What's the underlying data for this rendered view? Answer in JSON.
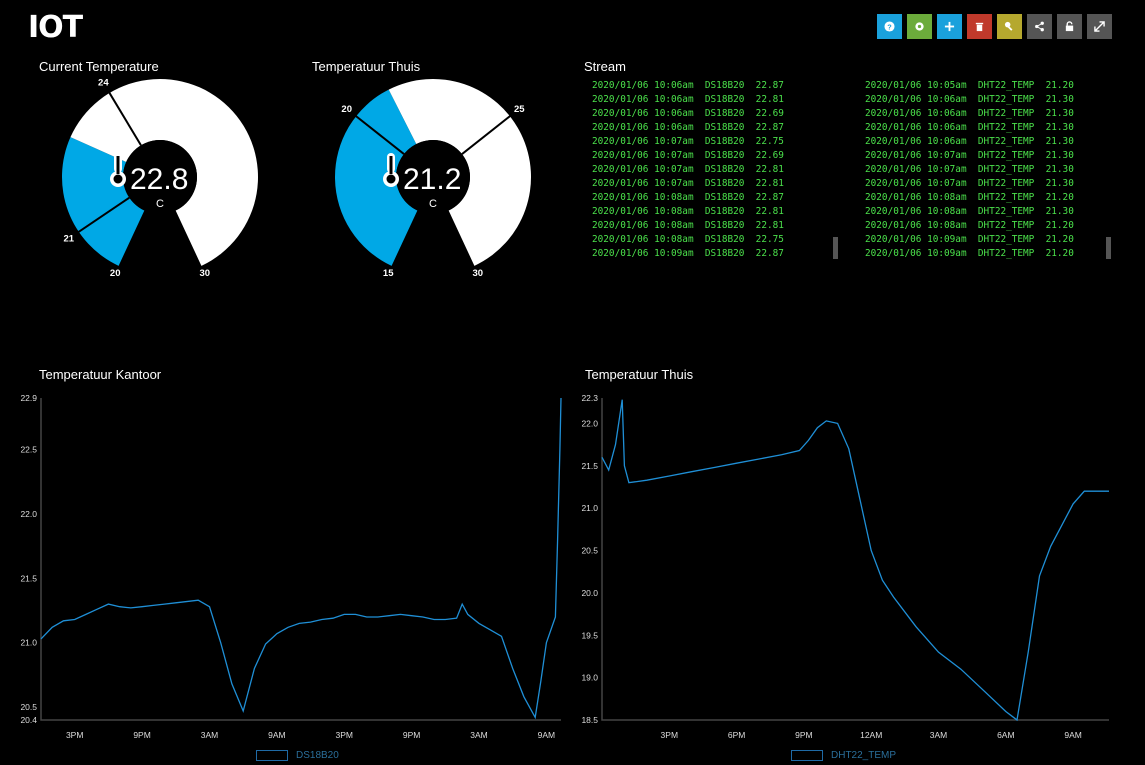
{
  "app": {
    "title": "IOT"
  },
  "toolbar": {
    "buttons": [
      {
        "name": "help",
        "icon": "question-icon",
        "color": "#1aa1dc"
      },
      {
        "name": "settings",
        "icon": "gear-icon",
        "color": "#6cab3b"
      },
      {
        "name": "add",
        "icon": "plus-icon",
        "color": "#1aa1dc"
      },
      {
        "name": "delete",
        "icon": "trash-icon",
        "color": "#c0392b"
      },
      {
        "name": "key",
        "icon": "key-icon",
        "color": "#b5a82e"
      },
      {
        "name": "share",
        "icon": "share-icon",
        "color": "#555555"
      },
      {
        "name": "lock",
        "icon": "lock-icon",
        "color": "#555555"
      },
      {
        "name": "fullscreen",
        "icon": "expand-icon",
        "color": "#555555"
      }
    ]
  },
  "gauges": [
    {
      "title": "Current Temperature",
      "value": "22.8",
      "unit": "C",
      "min": 20,
      "max": 30,
      "value_num": 22.87,
      "low_label": "21",
      "high_label": "24",
      "min_label": "20",
      "max_label": "30",
      "fill_color": "#00a8e6"
    },
    {
      "title": "Temperatuur Thuis",
      "value": "21.2",
      "unit": "C",
      "min": 15,
      "max": 30,
      "value_num": 21.2,
      "low_label": "20",
      "high_label": "25",
      "min_label": "15",
      "max_label": "30",
      "fill_color": "#00a8e6"
    }
  ],
  "stream": {
    "title": "Stream",
    "left": [
      "2020/01/06 10:06am  DS18B20  22.87",
      "2020/01/06 10:06am  DS18B20  22.81",
      "2020/01/06 10:06am  DS18B20  22.69",
      "2020/01/06 10:06am  DS18B20  22.87",
      "2020/01/06 10:07am  DS18B20  22.75",
      "2020/01/06 10:07am  DS18B20  22.69",
      "2020/01/06 10:07am  DS18B20  22.81",
      "2020/01/06 10:07am  DS18B20  22.81",
      "2020/01/06 10:08am  DS18B20  22.87",
      "2020/01/06 10:08am  DS18B20  22.81",
      "2020/01/06 10:08am  DS18B20  22.81",
      "2020/01/06 10:08am  DS18B20  22.75",
      "2020/01/06 10:09am  DS18B20  22.87"
    ],
    "right": [
      "2020/01/06 10:05am  DHT22_TEMP  21.20",
      "2020/01/06 10:06am  DHT22_TEMP  21.30",
      "2020/01/06 10:06am  DHT22_TEMP  21.30",
      "2020/01/06 10:06am  DHT22_TEMP  21.30",
      "2020/01/06 10:06am  DHT22_TEMP  21.30",
      "2020/01/06 10:07am  DHT22_TEMP  21.30",
      "2020/01/06 10:07am  DHT22_TEMP  21.30",
      "2020/01/06 10:07am  DHT22_TEMP  21.30",
      "2020/01/06 10:08am  DHT22_TEMP  21.20",
      "2020/01/06 10:08am  DHT22_TEMP  21.30",
      "2020/01/06 10:08am  DHT22_TEMP  21.20",
      "2020/01/06 10:09am  DHT22_TEMP  21.20",
      "2020/01/06 10:09am  DHT22_TEMP  21.20"
    ]
  },
  "chart_data": [
    {
      "type": "line",
      "title": "Temperatuur Kantoor",
      "series": [
        {
          "name": "DS18B20",
          "color": "#1f8fd6"
        }
      ],
      "ylim": [
        20.4,
        22.9
      ],
      "yticks": [
        "22.9",
        "22.5",
        "22.0",
        "21.5",
        "21.0",
        "20.5",
        "20.4"
      ],
      "ytick_values": [
        22.9,
        22.5,
        22.0,
        21.5,
        21.0,
        20.5,
        20.4
      ],
      "xticks": [
        "3PM",
        "9PM",
        "3AM",
        "9AM",
        "3PM",
        "9PM",
        "3AM",
        "9AM"
      ],
      "xtick_hours": [
        3,
        9,
        15,
        21,
        27,
        33,
        39,
        45
      ],
      "x_hours_range": [
        0,
        46.3
      ],
      "points": [
        [
          0,
          21.03
        ],
        [
          1,
          21.12
        ],
        [
          2,
          21.17
        ],
        [
          3,
          21.18
        ],
        [
          4,
          21.22
        ],
        [
          5,
          21.26
        ],
        [
          6,
          21.3
        ],
        [
          7,
          21.28
        ],
        [
          8,
          21.27
        ],
        [
          9,
          21.28
        ],
        [
          10,
          21.29
        ],
        [
          11,
          21.3
        ],
        [
          12,
          21.31
        ],
        [
          14,
          21.33
        ],
        [
          15,
          21.28
        ],
        [
          16,
          21.0
        ],
        [
          17,
          20.68
        ],
        [
          18,
          20.47
        ],
        [
          19,
          20.8
        ],
        [
          20,
          20.99
        ],
        [
          21,
          21.07
        ],
        [
          22,
          21.12
        ],
        [
          23,
          21.15
        ],
        [
          24,
          21.16
        ],
        [
          25,
          21.18
        ],
        [
          26,
          21.19
        ],
        [
          27,
          21.22
        ],
        [
          28,
          21.22
        ],
        [
          29,
          21.2
        ],
        [
          30,
          21.2
        ],
        [
          31,
          21.21
        ],
        [
          32,
          21.22
        ],
        [
          33,
          21.21
        ],
        [
          34,
          21.2
        ],
        [
          35,
          21.18
        ],
        [
          36,
          21.18
        ],
        [
          37,
          21.19
        ],
        [
          37.5,
          21.3
        ],
        [
          38,
          21.22
        ],
        [
          39,
          21.15
        ],
        [
          40,
          21.1
        ],
        [
          41,
          21.05
        ],
        [
          42,
          20.8
        ],
        [
          43,
          20.58
        ],
        [
          44,
          20.42
        ],
        [
          44.5,
          20.7
        ],
        [
          45,
          21.0
        ],
        [
          45.8,
          21.2
        ],
        [
          46,
          21.8
        ],
        [
          46.2,
          22.5
        ],
        [
          46.3,
          22.9
        ]
      ]
    },
    {
      "type": "line",
      "title": "Temperatuur Thuis",
      "series": [
        {
          "name": "DHT22_TEMP",
          "color": "#1f8fd6"
        }
      ],
      "ylim": [
        18.5,
        22.3
      ],
      "yticks": [
        "22.3",
        "22.0",
        "21.5",
        "21.0",
        "20.5",
        "20.0",
        "19.5",
        "19.0",
        "18.5"
      ],
      "ytick_values": [
        22.3,
        22.0,
        21.5,
        21.0,
        20.5,
        20.0,
        19.5,
        19.0,
        18.5
      ],
      "xticks": [
        "3PM",
        "6PM",
        "9PM",
        "12AM",
        "3AM",
        "6AM",
        "9AM"
      ],
      "xtick_hours": [
        3,
        6,
        9,
        12,
        15,
        18,
        21
      ],
      "x_hours_range": [
        0,
        22.6
      ],
      "points": [
        [
          0,
          21.6
        ],
        [
          0.3,
          21.45
        ],
        [
          0.6,
          21.75
        ],
        [
          0.9,
          22.28
        ],
        [
          1.0,
          21.5
        ],
        [
          1.2,
          21.3
        ],
        [
          2,
          21.33
        ],
        [
          3,
          21.38
        ],
        [
          4,
          21.43
        ],
        [
          5,
          21.48
        ],
        [
          6,
          21.53
        ],
        [
          7,
          21.58
        ],
        [
          8,
          21.63
        ],
        [
          8.8,
          21.68
        ],
        [
          9.2,
          21.8
        ],
        [
          9.6,
          21.95
        ],
        [
          10,
          22.03
        ],
        [
          10.5,
          22.0
        ],
        [
          11,
          21.7
        ],
        [
          11.5,
          21.1
        ],
        [
          12,
          20.5
        ],
        [
          12.5,
          20.15
        ],
        [
          13,
          19.95
        ],
        [
          14,
          19.6
        ],
        [
          15,
          19.3
        ],
        [
          16,
          19.1
        ],
        [
          17,
          18.85
        ],
        [
          18,
          18.6
        ],
        [
          18.5,
          18.5
        ],
        [
          19,
          19.3
        ],
        [
          19.5,
          20.2
        ],
        [
          20,
          20.55
        ],
        [
          21,
          21.05
        ],
        [
          21.5,
          21.2
        ],
        [
          22.6,
          21.2
        ]
      ]
    }
  ]
}
